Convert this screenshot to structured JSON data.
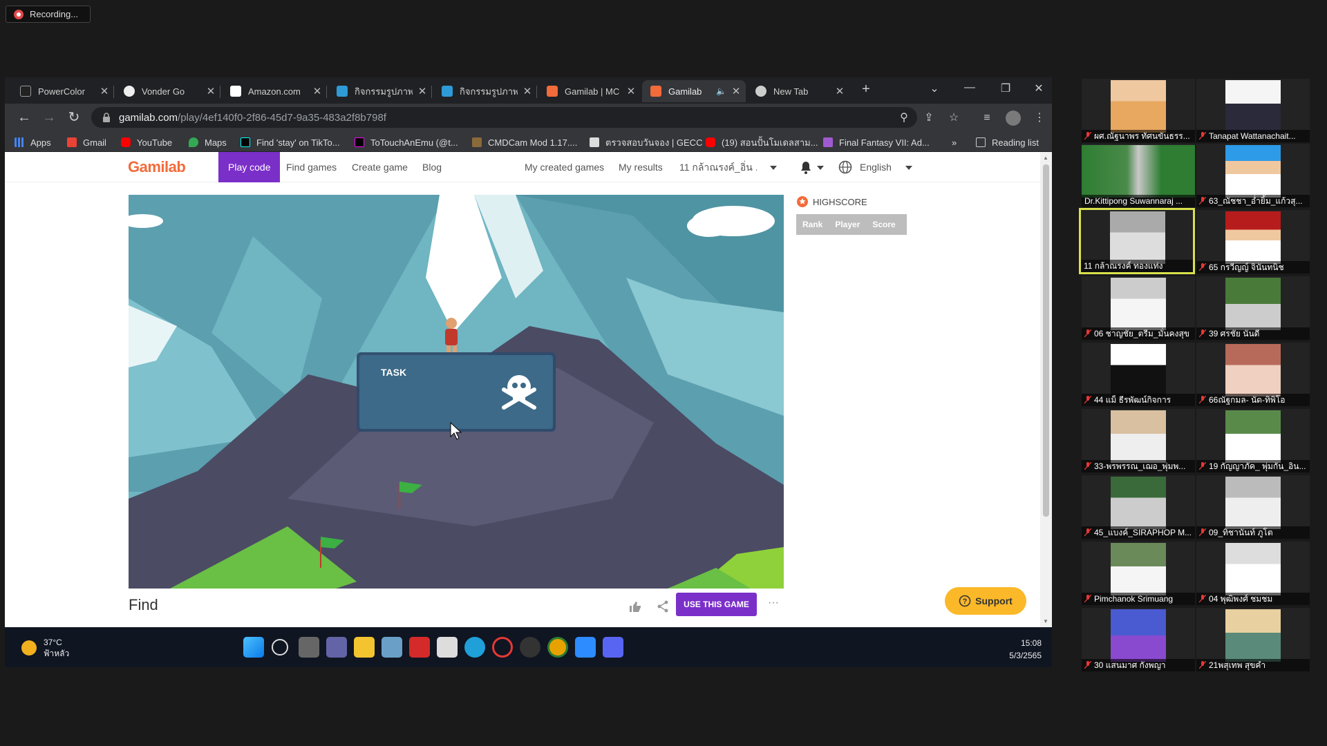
{
  "recording": {
    "label": "Recording..."
  },
  "browser": {
    "tabs": [
      {
        "title": "PowerColor",
        "active": false
      },
      {
        "title": "Vonder Go",
        "active": false
      },
      {
        "title": "Amazon.com",
        "active": false
      },
      {
        "title": "กิจกรรมรูปภาพ",
        "active": false
      },
      {
        "title": "กิจกรรมรูปภาพ",
        "active": false
      },
      {
        "title": "Gamilab | MC",
        "active": false
      },
      {
        "title": "Gamilab",
        "active": true
      },
      {
        "title": "New Tab",
        "active": false
      }
    ],
    "url_host": "gamilab.com",
    "url_path": "/play/4ef140f0-2f86-45d7-9a35-483a2f8b798f",
    "bookmarks": [
      "Apps",
      "Gmail",
      "YouTube",
      "Maps",
      "Find 'stay' on TikTo...",
      "ToTouchAnEmu (@t...",
      "CMDCam Mod 1.17....",
      "ตรวจสอบวันจอง | GECC",
      "(19) สอนปั้นโมเดลสาม...",
      "Final Fantasy VII: Ad..."
    ],
    "bookmarks_more": "»",
    "reading_list": "Reading list"
  },
  "site": {
    "logo": "Gamilab",
    "nav": {
      "play_code": "Play code",
      "find_games": "Find games",
      "create_game": "Create game",
      "blog": "Blog",
      "my_created_games": "My created games",
      "my_results": "My results",
      "user": "11 กล้าณรงค์_อิ่น ...",
      "language": "English"
    },
    "game": {
      "task_label": "TASK",
      "title": "Find",
      "use_button": "USE THIS GAME",
      "more": "···"
    },
    "highscore": {
      "title": "HIGHSCORE",
      "columns": [
        "Rank",
        "Player",
        "Score"
      ]
    },
    "support": "Support"
  },
  "taskbar": {
    "temperature": "37°C",
    "weather_desc": "ฟ้าหลัว",
    "time": "15:08",
    "date": "5/3/2565"
  },
  "participants": [
    "ผศ.ณัฐนาพร ทัศนขันธรร...",
    "Tanapat Wattanachait...",
    "Dr.Kittipong Suwannaraj ...",
    "63_ณัชชา_อ่ำยิ้ม_แก้วสุ...",
    "11 กล้าณรงค์ ทองแท่ง",
    "65 กรวีญญ์ จินันทนิช",
    "06 ชาญชัย_ตรีม_มั่นคงสุข",
    "39 ศรชัย นันดี",
    "44 แม็ ธีรพัฒน์กิจการ",
    "66ณัฐกมล- นัด-ทิพิโอ",
    "33-พรพรรณ_เฌอ_พุ่มพ...",
    "19 กัญญาภัค_ พุ่มกัน_อิน...",
    "45_แบงค์_SIRAPHOP M...",
    "09_ทิชานันท์ ภูโต",
    "Pimchanok Srimuang",
    "04 พุฒิพงศ์ ชมชม",
    "30 แสนมาศ กังพญา",
    "21พสุเทพ สุขคำ"
  ],
  "colors": {
    "accent": "#7b2fc9",
    "brand": "#f26b3a",
    "support": "#fbb829",
    "speaker_highlight": "#d9e24b"
  }
}
